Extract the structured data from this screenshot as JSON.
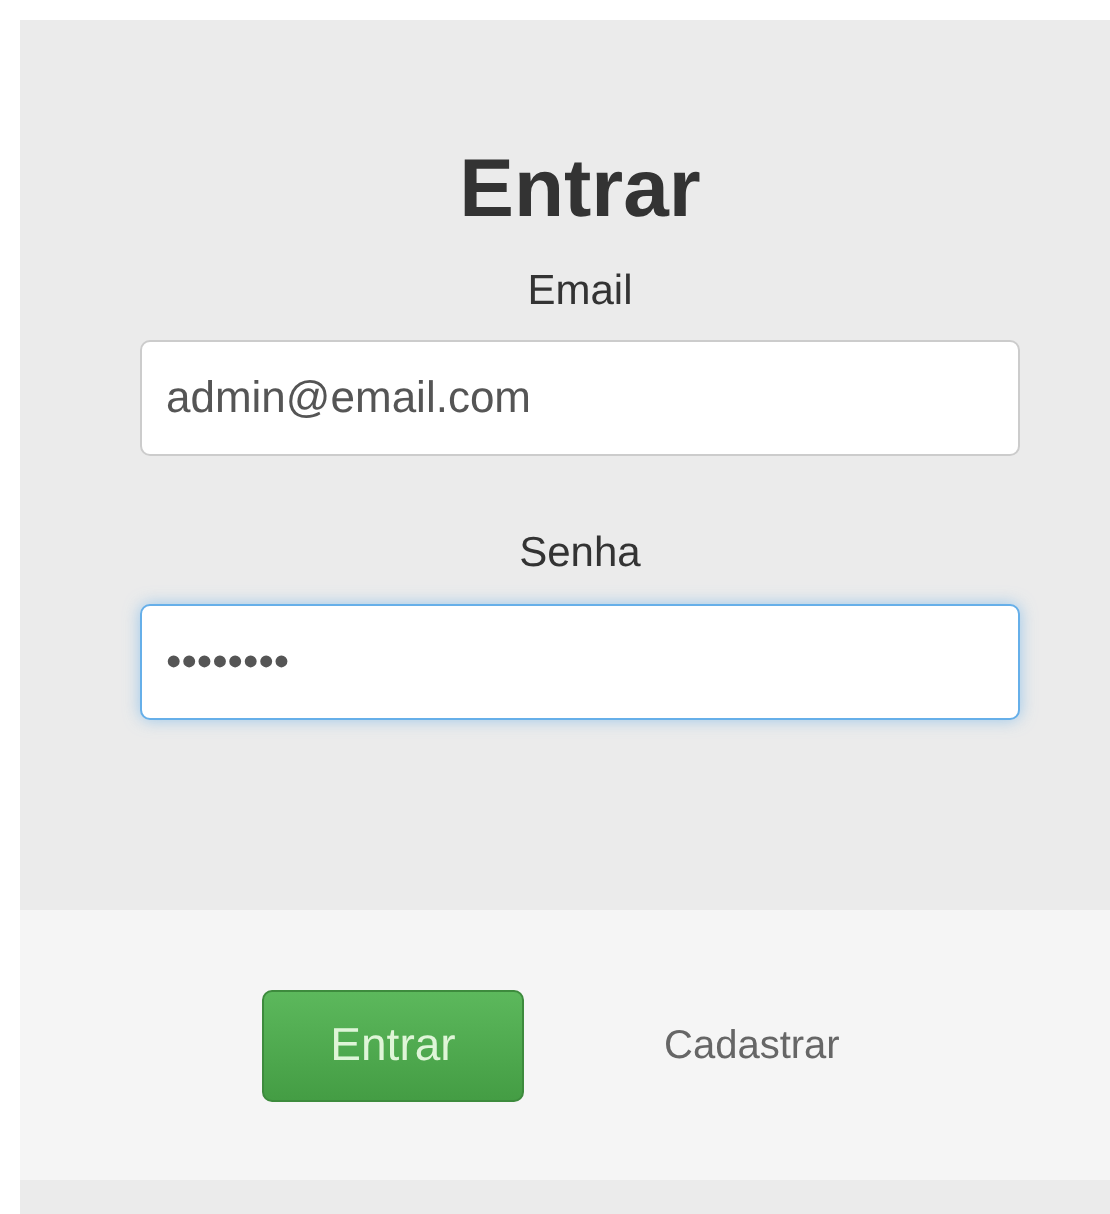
{
  "title": "Entrar",
  "fields": [
    {
      "label": "Email",
      "value": "admin@email.com",
      "focused": false
    },
    {
      "label": "Senha",
      "value": "••••••••",
      "focused": true
    }
  ],
  "buttons": [
    {
      "label": "Entrar",
      "kind": "primary"
    },
    {
      "label": "Cadastrar",
      "kind": "link"
    }
  ]
}
